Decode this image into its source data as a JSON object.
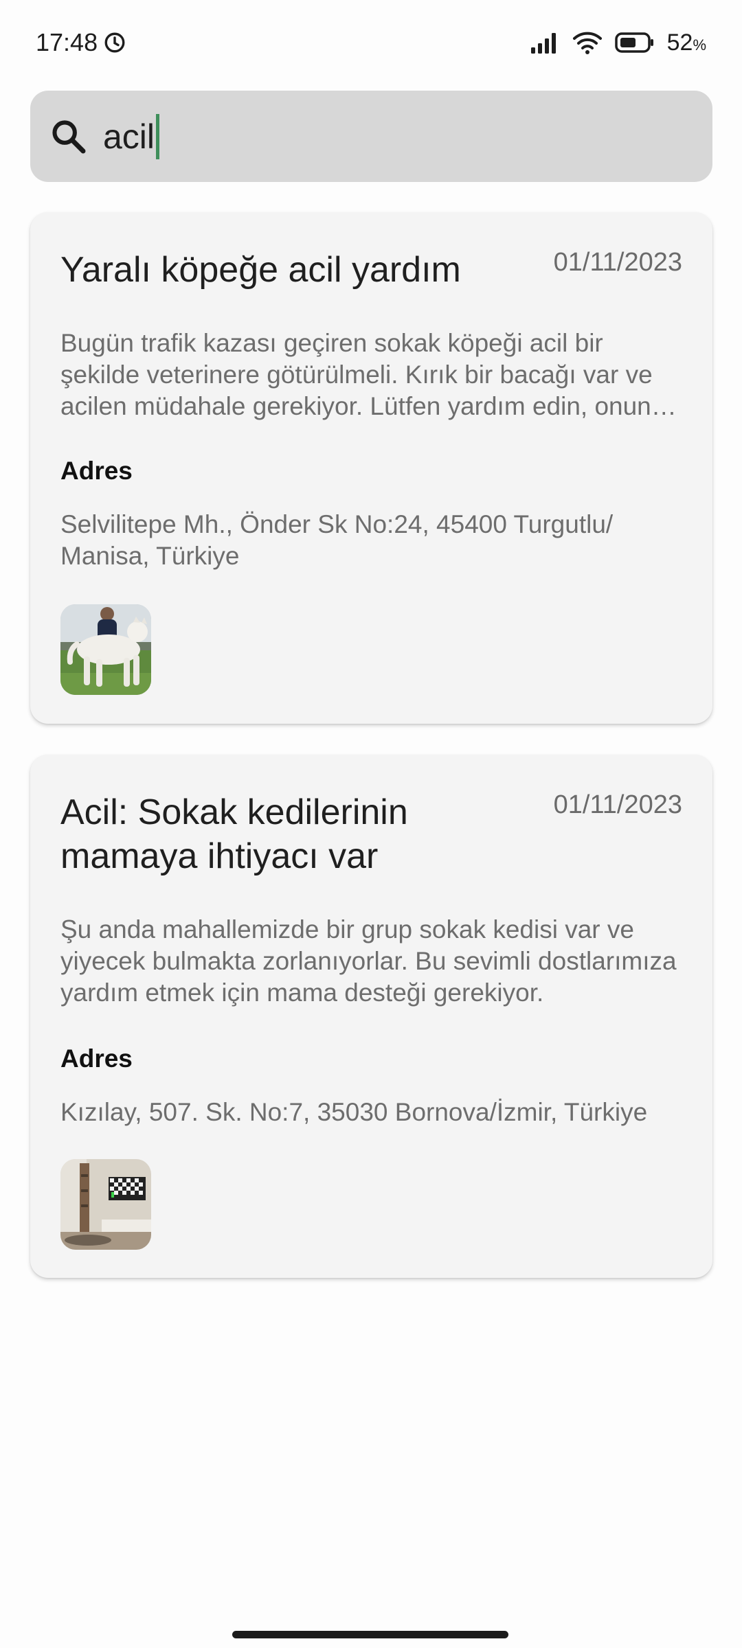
{
  "status_bar": {
    "time": "17:48",
    "battery_percent": "52",
    "battery_unit": "%"
  },
  "search": {
    "value": "acil",
    "placeholder": ""
  },
  "posts": [
    {
      "title": "Yaralı köpeğe acil yardım",
      "date": "01/11/2023",
      "description": "Bugün trafik kazası geçiren sokak köpeği acil bir şekilde veterinere götürülmeli. Kırık bir bacağı var ve acilen müdahale gerekiyor. Lütfen yardım edin, onun hayatını kurtarmak için desteğinize ihtiyacımız var.",
      "address_label": "Adres",
      "address": "Selvilitepe Mh., Önder Sk No:24, 45400 Turgutlu/ Manisa, Türkiye"
    },
    {
      "title": "Acil: Sokak kedilerinin mamaya ihtiyacı var",
      "date": "01/11/2023",
      "description": "Şu anda mahallemizde bir grup sokak kedisi var ve yiyecek bulmakta zorlanıyorlar. Bu sevimli dostlarımıza yardım etmek için mama desteği gerekiyor.",
      "address_label": "Adres",
      "address": "Kızılay, 507. Sk. No:7, 35030 Bornova/İzmir, Türkiye"
    }
  ],
  "colors": {
    "search_bg": "#d7d7d7",
    "card_bg": "#f4f4f4",
    "cursor": "#3f8f5b"
  }
}
